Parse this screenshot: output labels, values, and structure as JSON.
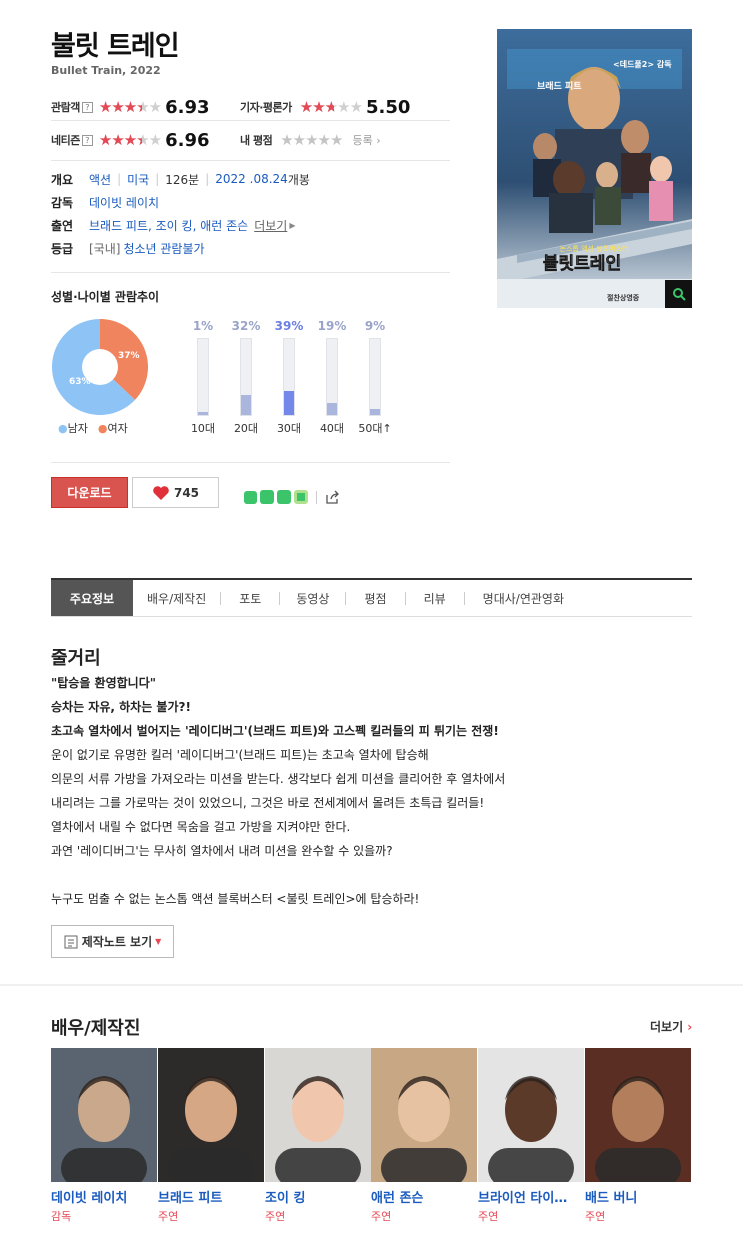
{
  "movie": {
    "title_ko": "불릿 트레인",
    "title_en": "Bullet Train, 2022"
  },
  "ratings": {
    "audience": {
      "label": "관람객",
      "score": "6.93",
      "stars": 3.5
    },
    "critics": {
      "label": "기자·평론가",
      "score": "5.50",
      "stars": 2.75
    },
    "netizen": {
      "label": "네티즌",
      "score": "6.96",
      "stars": 3.5
    },
    "mine": {
      "label": "내 평점",
      "action": "등록"
    },
    "help_mark": "?"
  },
  "info": {
    "genre_label": "개요",
    "genre": "액션",
    "country": "미국",
    "runtime": "126분",
    "release": "2022 .08.24",
    "release_suffix": "개봉",
    "director_label": "감독",
    "director": "데이빗 레이치",
    "cast_label": "출연",
    "cast": "브래드 피트, 조이 킹, 애런 존슨",
    "more": "더보기",
    "grade_label": "등급",
    "grade_region": "[국내]",
    "grade": "청소년 관람불가"
  },
  "poster": {
    "tagline": "논스톱 액션 블록버스터",
    "title": "불릿트레인",
    "top_left": "브래드 피트",
    "top_right": "<데드풀2> 감독",
    "bottom": "절찬상영중"
  },
  "demographics": {
    "title": "성별·나이별 관람추이",
    "gender": [
      {
        "label": "남자",
        "percent": 63,
        "color": "#8dc3f5"
      },
      {
        "label": "여자",
        "percent": 37,
        "color": "#f0845e"
      }
    ],
    "ages": [
      {
        "label": "10대",
        "percent": 1,
        "text": "1%"
      },
      {
        "label": "20대",
        "percent": 32,
        "text": "32%"
      },
      {
        "label": "30대",
        "percent": 39,
        "text": "39%",
        "highlight": true
      },
      {
        "label": "40대",
        "percent": 19,
        "text": "19%"
      },
      {
        "label": "50대",
        "percent": 9,
        "text": "9%"
      }
    ],
    "male_text": "63%",
    "female_text": "37%"
  },
  "actions": {
    "download": "다운로드",
    "likes": "745"
  },
  "tabs": [
    "주요정보",
    "배우/제작진",
    "포토",
    "동영상",
    "평점",
    "리뷰",
    "명대사/연관영화"
  ],
  "synopsis": {
    "title": "줄거리",
    "lines_bold": [
      "\"탑승을 환영합니다\"",
      "승차는 자유, 하차는 불가?!",
      "초고속 열차에서 벌어지는 '레이디버그'(브래드 피트)와 고스펙 킬러들의 피 튀기는 전쟁!"
    ],
    "lines": [
      "운이 없기로 유명한 킬러 '레이디버그'(브래드 피트)는 초고속 열차에 탑승해",
      " 의문의 서류 가방을 가져오라는 미션을 받는다. 생각보다 쉽게 미션을 클리어한 후 열차에서",
      " 내리려는 그를 가로막는 것이 있었으니, 그것은 바로 전세계에서 몰려든 초특급 킬러들!",
      " 열차에서 내릴 수 없다면 목숨을 걸고 가방을 지켜야만 한다.",
      " 과연 '레이디버그'는 무사히 열차에서 내려 미션을 완수할 수 있을까?",
      " 누구도 멈출 수 없는 논스톱 액션 블록버스터 <불릿 트레인>에 탑승하라!"
    ],
    "note_button": "제작노트 보기"
  },
  "cast_section": {
    "title": "배우/제작진",
    "more": "더보기",
    "people": [
      {
        "name": "데이빗 레이치",
        "role": "감독",
        "bg": "#5a6470",
        "skin": "#c9a88c"
      },
      {
        "name": "브래드 피트",
        "role": "주연",
        "bg": "#2d2a2a",
        "skin": "#d6a784"
      },
      {
        "name": "조이 킹",
        "role": "주연",
        "bg": "#d9d7d4",
        "skin": "#f0c7ad"
      },
      {
        "name": "애런 존슨",
        "role": "주연",
        "bg": "#c8a785",
        "skin": "#e6c2a3"
      },
      {
        "name": "브라이언 타이…",
        "role": "주연",
        "bg": "#e4e4e4",
        "skin": "#5b3a2a"
      },
      {
        "name": "배드 버니",
        "role": "주연",
        "bg": "#5a2e22",
        "skin": "#b27e5c"
      }
    ]
  }
}
